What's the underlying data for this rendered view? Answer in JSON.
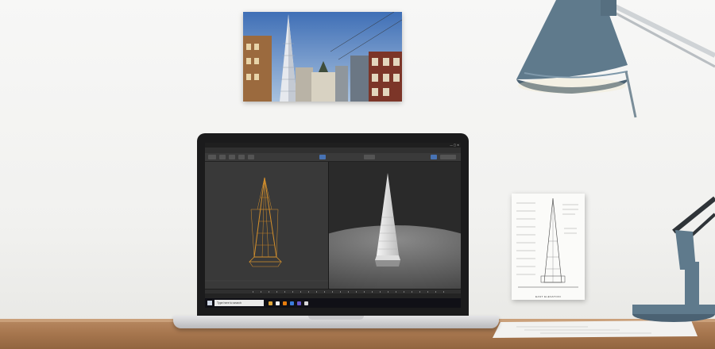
{
  "scene": {
    "description_colors": {
      "wall": "#f3f3f1",
      "desk": "#a8774f",
      "lamp": "#5f7a8c",
      "laptop_bezel": "#1b1b1c"
    }
  },
  "screen": {
    "search_placeholder": "Type here to search",
    "icons": [
      "windows-icon",
      "chrome-icon",
      "file-explorer-icon",
      "blender-icon",
      "mail-icon",
      "store-icon"
    ],
    "accent": "#4772b3",
    "selected_object_color": "#d4902d"
  },
  "blueprint": {
    "caption": "EAST ELEVATION"
  }
}
